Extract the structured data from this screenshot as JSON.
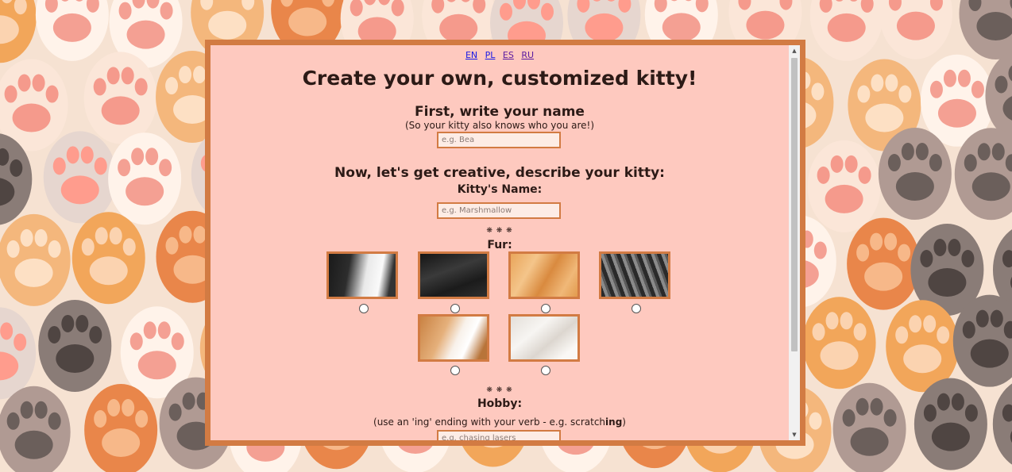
{
  "languages": [
    "EN",
    "PL",
    "ES",
    "RU"
  ],
  "title": "Create your own, customized kitty!",
  "name_section": {
    "heading": "First, write your name",
    "subtext": "(So your kitty also knows who you are!)",
    "placeholder": "e.g. Bea"
  },
  "kitty_section": {
    "heading": "Now, let's get creative, describe your kitty:",
    "name_label": "Kitty's Name:",
    "name_placeholder": "e.g. Marshmallow",
    "separator": "❋ ❋ ❋",
    "fur_label": "Fur:",
    "fur_options": [
      "black-and-white",
      "black",
      "orange",
      "grey-tabby",
      "calico",
      "white"
    ],
    "hobby_label": "Hobby:",
    "hobby_hint_prefix": "(use an 'ing' ending with your verb - e.g. scratch",
    "hobby_hint_bold": "ing",
    "hobby_hint_suffix": ")",
    "hobby_placeholder": "e.g. chasing lasers"
  },
  "colors": {
    "frame": "#d27b43",
    "panel": "#fec9bf"
  },
  "icons": {
    "scroll_up": "scroll-up-arrow-icon",
    "scroll_down": "scroll-down-arrow-icon"
  }
}
